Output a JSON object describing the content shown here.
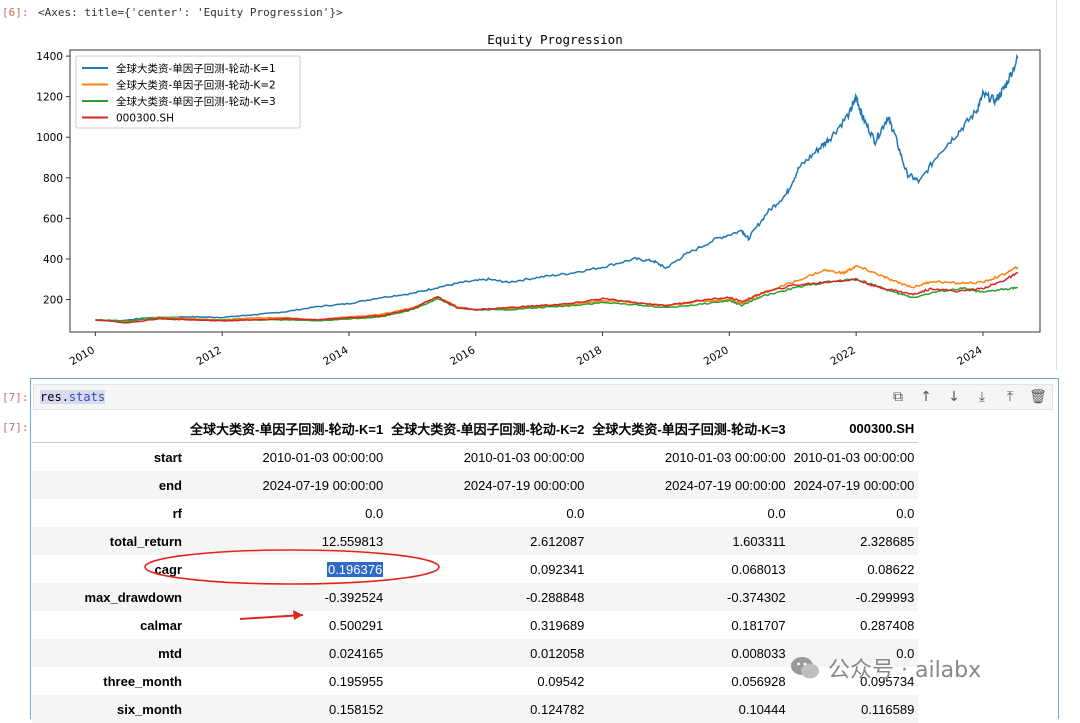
{
  "cell6": {
    "prompt": "[6]:",
    "output_text": "<Axes: title={'center': 'Equity Progression'}>"
  },
  "chart_data": {
    "type": "line",
    "title": "Equity Progression",
    "xlabel": "",
    "ylabel": "",
    "xlim": [
      2009.6,
      2024.9
    ],
    "ylim": [
      40,
      1430
    ],
    "yticks": [
      200,
      400,
      600,
      800,
      1000,
      1200,
      1400
    ],
    "xticks": [
      "2010",
      "2012",
      "2014",
      "2016",
      "2018",
      "2020",
      "2022",
      "2024"
    ],
    "legend_position": "upper-left",
    "series": [
      {
        "name": "全球大类资-单因子回测-轮动-K=1",
        "color": "#1f77b4",
        "points": [
          [
            2010.0,
            100
          ],
          [
            2010.4,
            95
          ],
          [
            2010.8,
            110
          ],
          [
            2011.5,
            115
          ],
          [
            2012.0,
            112
          ],
          [
            2012.5,
            125
          ],
          [
            2013.0,
            140
          ],
          [
            2013.5,
            165
          ],
          [
            2014.0,
            180
          ],
          [
            2014.5,
            210
          ],
          [
            2015.0,
            230
          ],
          [
            2015.4,
            260
          ],
          [
            2015.8,
            285
          ],
          [
            2016.2,
            300
          ],
          [
            2016.5,
            285
          ],
          [
            2017.0,
            310
          ],
          [
            2017.5,
            330
          ],
          [
            2018.0,
            360
          ],
          [
            2018.5,
            400
          ],
          [
            2018.8,
            390
          ],
          [
            2019.0,
            355
          ],
          [
            2019.3,
            420
          ],
          [
            2019.8,
            500
          ],
          [
            2020.2,
            540
          ],
          [
            2020.3,
            500
          ],
          [
            2020.6,
            630
          ],
          [
            2020.9,
            720
          ],
          [
            2021.1,
            850
          ],
          [
            2021.4,
            940
          ],
          [
            2021.6,
            1000
          ],
          [
            2021.9,
            1120
          ],
          [
            2022.0,
            1200
          ],
          [
            2022.1,
            1100
          ],
          [
            2022.3,
            980
          ],
          [
            2022.5,
            1100
          ],
          [
            2022.6,
            1020
          ],
          [
            2022.8,
            820
          ],
          [
            2023.0,
            780
          ],
          [
            2023.3,
            920
          ],
          [
            2023.6,
            1020
          ],
          [
            2023.9,
            1130
          ],
          [
            2024.0,
            1210
          ],
          [
            2024.2,
            1180
          ],
          [
            2024.35,
            1250
          ],
          [
            2024.55,
            1390
          ]
        ]
      },
      {
        "name": "全球大类资-单因子回测-轮动-K=2",
        "color": "#ff7f0e",
        "points": [
          [
            2010.0,
            100
          ],
          [
            2010.5,
            92
          ],
          [
            2011.0,
            115
          ],
          [
            2011.5,
            105
          ],
          [
            2012.0,
            100
          ],
          [
            2012.5,
            110
          ],
          [
            2013.0,
            110
          ],
          [
            2013.5,
            100
          ],
          [
            2014.0,
            115
          ],
          [
            2014.5,
            125
          ],
          [
            2015.0,
            160
          ],
          [
            2015.4,
            215
          ],
          [
            2015.7,
            165
          ],
          [
            2016.0,
            150
          ],
          [
            2016.5,
            155
          ],
          [
            2017.0,
            165
          ],
          [
            2017.5,
            175
          ],
          [
            2018.0,
            195
          ],
          [
            2018.5,
            185
          ],
          [
            2019.0,
            170
          ],
          [
            2019.5,
            190
          ],
          [
            2020.0,
            200
          ],
          [
            2020.2,
            180
          ],
          [
            2020.5,
            230
          ],
          [
            2021.0,
            285
          ],
          [
            2021.5,
            345
          ],
          [
            2021.8,
            330
          ],
          [
            2022.0,
            365
          ],
          [
            2022.3,
            330
          ],
          [
            2022.6,
            290
          ],
          [
            2022.9,
            260
          ],
          [
            2023.2,
            290
          ],
          [
            2023.6,
            280
          ],
          [
            2024.0,
            285
          ],
          [
            2024.3,
            320
          ],
          [
            2024.55,
            360
          ]
        ]
      },
      {
        "name": "全球大类资-单因子回测-轮动-K=3",
        "color": "#2ca02c",
        "points": [
          [
            2010.0,
            100
          ],
          [
            2010.5,
            95
          ],
          [
            2011.0,
            110
          ],
          [
            2011.5,
            100
          ],
          [
            2012.0,
            98
          ],
          [
            2012.5,
            100
          ],
          [
            2013.0,
            100
          ],
          [
            2013.5,
            95
          ],
          [
            2014.0,
            105
          ],
          [
            2014.5,
            115
          ],
          [
            2015.0,
            150
          ],
          [
            2015.4,
            205
          ],
          [
            2015.7,
            160
          ],
          [
            2016.0,
            150
          ],
          [
            2016.5,
            150
          ],
          [
            2017.0,
            160
          ],
          [
            2017.5,
            170
          ],
          [
            2018.0,
            185
          ],
          [
            2018.5,
            175
          ],
          [
            2019.0,
            160
          ],
          [
            2019.5,
            175
          ],
          [
            2020.0,
            195
          ],
          [
            2020.2,
            170
          ],
          [
            2020.5,
            215
          ],
          [
            2021.0,
            255
          ],
          [
            2021.5,
            285
          ],
          [
            2022.0,
            300
          ],
          [
            2022.3,
            270
          ],
          [
            2022.6,
            235
          ],
          [
            2022.9,
            210
          ],
          [
            2023.3,
            240
          ],
          [
            2023.7,
            255
          ],
          [
            2024.0,
            235
          ],
          [
            2024.3,
            250
          ],
          [
            2024.55,
            260
          ]
        ]
      },
      {
        "name": "000300.SH",
        "color": "#d62728",
        "points": [
          [
            2010.0,
            100
          ],
          [
            2010.5,
            85
          ],
          [
            2011.0,
            105
          ],
          [
            2011.5,
            100
          ],
          [
            2012.0,
            95
          ],
          [
            2012.5,
            100
          ],
          [
            2013.0,
            105
          ],
          [
            2013.5,
            100
          ],
          [
            2014.0,
            110
          ],
          [
            2014.5,
            120
          ],
          [
            2015.0,
            155
          ],
          [
            2015.4,
            215
          ],
          [
            2015.7,
            160
          ],
          [
            2016.0,
            150
          ],
          [
            2016.5,
            160
          ],
          [
            2017.0,
            170
          ],
          [
            2017.5,
            180
          ],
          [
            2018.0,
            205
          ],
          [
            2018.5,
            185
          ],
          [
            2019.0,
            170
          ],
          [
            2019.5,
            195
          ],
          [
            2020.0,
            210
          ],
          [
            2020.2,
            190
          ],
          [
            2020.5,
            230
          ],
          [
            2021.0,
            270
          ],
          [
            2021.5,
            285
          ],
          [
            2022.0,
            300
          ],
          [
            2022.3,
            265
          ],
          [
            2022.6,
            245
          ],
          [
            2022.9,
            225
          ],
          [
            2023.2,
            255
          ],
          [
            2023.6,
            240
          ],
          [
            2024.0,
            255
          ],
          [
            2024.3,
            290
          ],
          [
            2024.55,
            330
          ]
        ]
      }
    ]
  },
  "cell7": {
    "input_prompt": "[7]:",
    "output_prompt": "[7]:",
    "code_obj": "res",
    "code_dot": ".",
    "code_attr": "stats",
    "toolbar_icons": [
      "duplicate-icon",
      "move-up-icon",
      "move-down-icon",
      "insert-below-icon",
      "insert-above-icon",
      "delete-icon"
    ],
    "toolbar_glyphs": [
      "⧉",
      "↑",
      "↓",
      "⤓",
      "⤒",
      "🗑"
    ]
  },
  "stats_table": {
    "columns": [
      "",
      "全球大类资-单因子回测-轮动-K=1",
      "全球大类资-单因子回测-轮动-K=2",
      "全球大类资-单因子回测-轮动-K=3",
      "000300.SH"
    ],
    "rows": [
      {
        "label": "start",
        "values": [
          "2010-01-03 00:00:00",
          "2010-01-03 00:00:00",
          "2010-01-03 00:00:00",
          "2010-01-03 00:00:00"
        ]
      },
      {
        "label": "end",
        "values": [
          "2024-07-19 00:00:00",
          "2024-07-19 00:00:00",
          "2024-07-19 00:00:00",
          "2024-07-19 00:00:00"
        ]
      },
      {
        "label": "rf",
        "values": [
          "0.0",
          "0.0",
          "0.0",
          "0.0"
        ]
      },
      {
        "label": "total_return",
        "values": [
          "12.559813",
          "2.612087",
          "1.603311",
          "2.328685"
        ]
      },
      {
        "label": "cagr",
        "values": [
          "0.196376",
          "0.092341",
          "0.068013",
          "0.08622"
        ]
      },
      {
        "label": "max_drawdown",
        "values": [
          "-0.392524",
          "-0.288848",
          "-0.374302",
          "-0.299993"
        ]
      },
      {
        "label": "calmar",
        "values": [
          "0.500291",
          "0.319689",
          "0.181707",
          "0.287408"
        ]
      },
      {
        "label": "mtd",
        "values": [
          "0.024165",
          "0.012058",
          "0.008033",
          "0.0"
        ]
      },
      {
        "label": "three_month",
        "values": [
          "0.195955",
          "0.09542",
          "0.056928",
          "0.095734"
        ]
      },
      {
        "label": "six_month",
        "values": [
          "0.158152",
          "0.124782",
          "0.10444",
          "0.116589"
        ]
      }
    ]
  },
  "watermark": {
    "text": "公众号 · ailabx"
  }
}
